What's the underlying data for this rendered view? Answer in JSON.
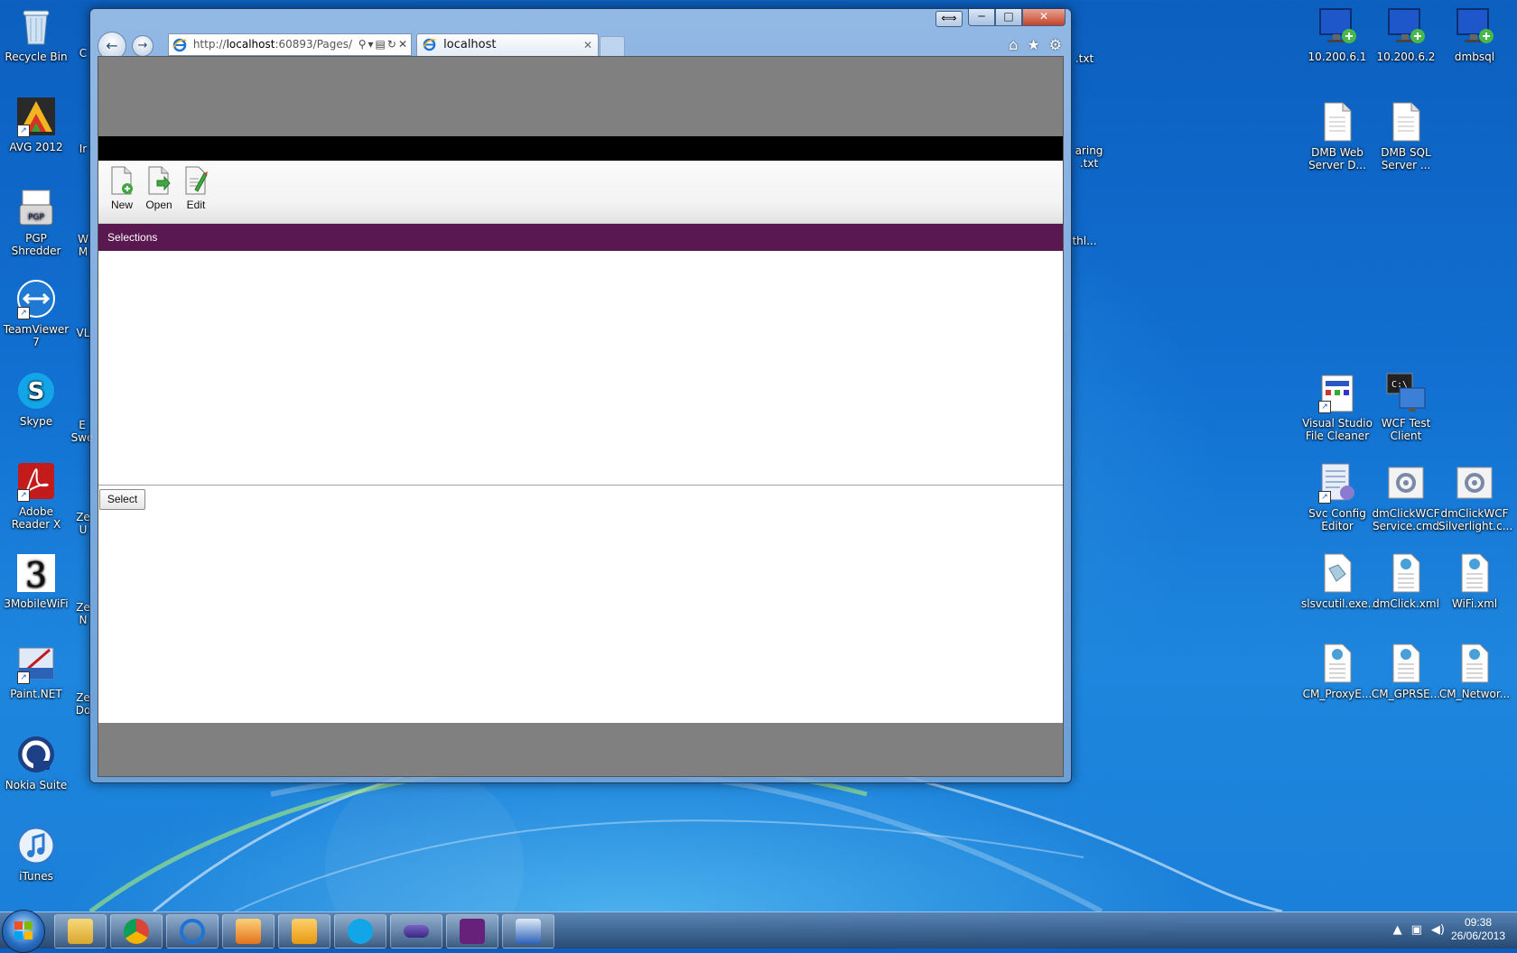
{
  "desktop": {
    "left_icons": [
      {
        "name": "recycle-bin",
        "label": "Recycle Bin"
      },
      {
        "name": "avg",
        "label": "AVG 2012"
      },
      {
        "name": "pgp-shredder",
        "label": "PGP Shredder"
      },
      {
        "name": "teamviewer",
        "label": "TeamViewer 7"
      },
      {
        "name": "skype",
        "label": "Skype"
      },
      {
        "name": "adobe-reader",
        "label": "Adobe Reader X"
      },
      {
        "name": "3mobilewifi",
        "label": "3MobileWiFi"
      },
      {
        "name": "paintnet",
        "label": "Paint.NET"
      },
      {
        "name": "nokia-suite",
        "label": "Nokia Suite"
      },
      {
        "name": "itunes",
        "label": "iTunes"
      }
    ],
    "right_icons": [
      {
        "name": "rdp-1",
        "label": "10.200.6.1"
      },
      {
        "name": "rdp-2",
        "label": "10.200.6.2"
      },
      {
        "name": "rdp-dmbsql",
        "label": "dmbsql"
      },
      {
        "name": "dmb-web-server",
        "label": "DMB Web Server D..."
      },
      {
        "name": "dmb-sql-server",
        "label": "DMB SQL Server ..."
      },
      {
        "name": "vs-file-cleaner",
        "label": "Visual Studio File Cleaner"
      },
      {
        "name": "wcf-test-client",
        "label": "WCF Test Client"
      },
      {
        "name": "svc-config-editor",
        "label": "Svc Config Editor"
      },
      {
        "name": "dmclick-wcf-service",
        "label": "dmClickWCF Service.cmd"
      },
      {
        "name": "dmclick-wcf-silverlight",
        "label": "dmClickWCF Silverlight.c..."
      },
      {
        "name": "slsvcutil",
        "label": "slsvcutil.exe..."
      },
      {
        "name": "dmclick-xml",
        "label": "dmClick.xml"
      },
      {
        "name": "wifi-xml",
        "label": "WiFi.xml"
      },
      {
        "name": "cm-proxy",
        "label": "CM_ProxyE..."
      },
      {
        "name": "cm-gprs",
        "label": "CM_GPRSE..."
      },
      {
        "name": "cm-network",
        "label": "CM_Networ..."
      }
    ],
    "peek_labels": [
      "C",
      "Ir",
      "W M",
      "VL",
      "E Swe",
      "Ze U",
      "Ze N",
      "Ze Do",
      ".txt",
      "aring .txt",
      "thl..."
    ]
  },
  "browser": {
    "address_prefix": "http://",
    "address_host": "localhost",
    "address_rest": ":60893/Pages/",
    "tab_title": "localhost",
    "caption": {
      "minimize": "─",
      "maximize": "□",
      "close": "✕",
      "resize": "⟺"
    }
  },
  "page": {
    "ribbon": [
      {
        "name": "new",
        "label": "New"
      },
      {
        "name": "open",
        "label": "Open"
      },
      {
        "name": "edit",
        "label": "Edit"
      }
    ],
    "section_title": "Selections",
    "select_button": "Select"
  },
  "taskbar": {
    "time": "09:38",
    "date": "26/06/2013",
    "tray_arrow": "▲"
  },
  "colors": {
    "section_bar": "#591850",
    "header_grey": "#808080"
  }
}
